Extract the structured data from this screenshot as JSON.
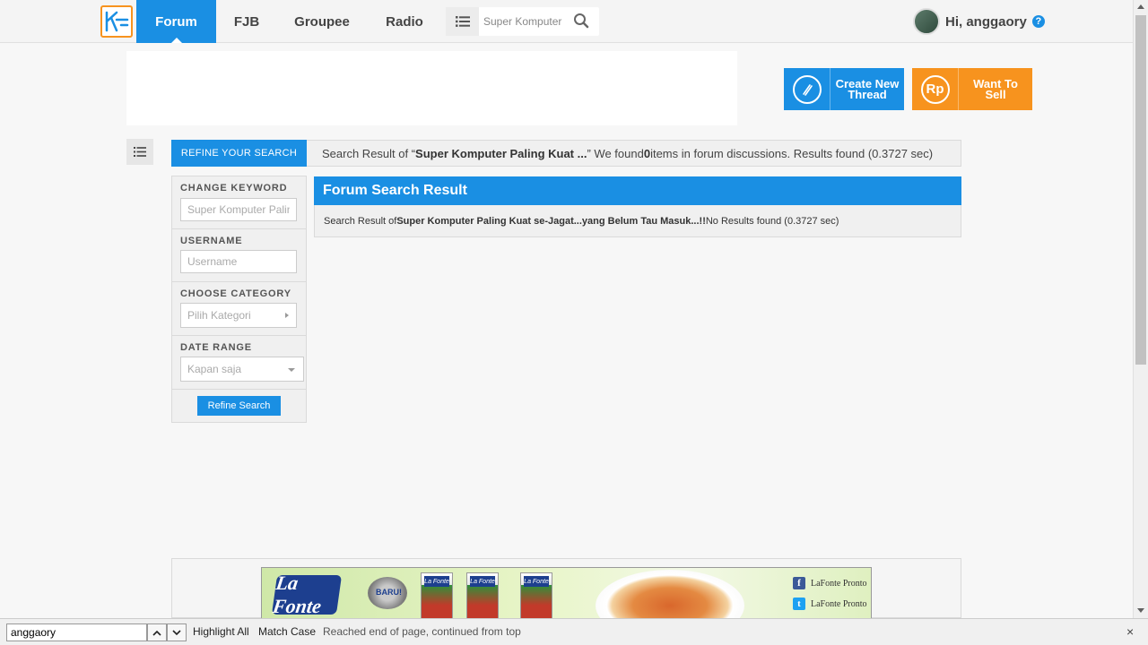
{
  "nav": {
    "items": [
      {
        "label": "Forum",
        "active": true
      },
      {
        "label": "FJB"
      },
      {
        "label": "Groupee"
      },
      {
        "label": "Radio"
      }
    ],
    "search_value": "Super Komputer",
    "user_greeting": "Hi, anggaory",
    "help_glyph": "?"
  },
  "cta": {
    "create_label": "Create New Thread",
    "sell_label": "Want To Sell",
    "sell_icon_text": "Rp"
  },
  "refine": {
    "header": "REFINE YOUR SEARCH",
    "keyword_title": "CHANGE KEYWORD",
    "keyword_value": "Super Komputer Paling Kuat se-Jagat...yang Belum Tau Masuk...!!",
    "username_title": "USERNAME",
    "username_placeholder": "Username",
    "category_title": "CHOOSE CATEGORY",
    "category_value": "Pilih Kategori",
    "date_title": "DATE RANGE",
    "date_value": "Kapan saja",
    "button": "Refine Search"
  },
  "summary": {
    "prefix": "Search Result of “",
    "keyword": "Super Komputer Paling Kuat ...",
    "middle": "” We found ",
    "count": "0",
    "suffix": " items in forum discussions. Results found (0.3727 sec)"
  },
  "result": {
    "title": "Forum Search Result",
    "prefix": "Search Result of ",
    "keyword": "Super Komputer Paling Kuat se-Jagat...yang Belum Tau Masuk...!!",
    "suffix": " No Results found (0.3727 sec)"
  },
  "promo": {
    "brand": "La Fonte",
    "badge": "BARU!",
    "pack_label": "La Fonte",
    "facebook": "LaFonte Pronto",
    "twitter": "LaFonte Pronto"
  },
  "findbar": {
    "value": "anggaory",
    "highlight_all": "Highlight All",
    "match_case": "Match Case",
    "status": "Reached end of page, continued from top",
    "close": "×"
  },
  "colors": {
    "brand_blue": "#1a8fe3",
    "brand_orange": "#f7931e"
  },
  "icons": [
    "kaskus-logo-icon",
    "list-icon",
    "search-icon",
    "help-icon",
    "pencil-icon",
    "chevron-up-icon",
    "chevron-down-icon",
    "close-icon",
    "facebook-icon",
    "twitter-icon"
  ]
}
